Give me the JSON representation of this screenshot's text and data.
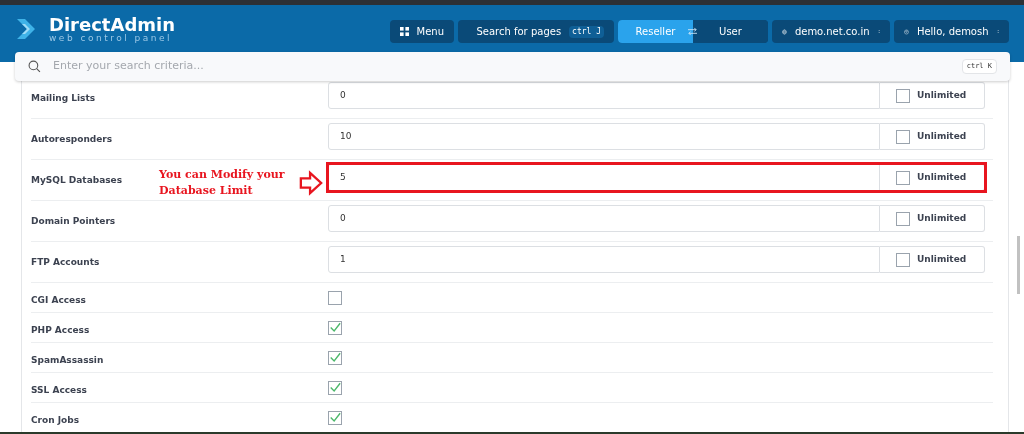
{
  "header": {
    "logo_title": "DirectAdmin",
    "logo_subtitle": "web control panel",
    "menu_button": "Menu",
    "page_search": {
      "label": "Search for pages",
      "shortcut": "ctrl J"
    },
    "role_switch": [
      {
        "label": "Reseller",
        "selected": true
      },
      {
        "label": "User",
        "selected": false
      }
    ],
    "domain_select": "demo.net.co.in",
    "user_menu": "Hello, demosh"
  },
  "search": {
    "placeholder": "Enter your search criteria...",
    "shortcut": "ctrl K"
  },
  "rows": [
    {
      "kind": "number",
      "label": "Mailing Lists",
      "value": "0",
      "unlimited_label": "Unlimited",
      "unlimited": false,
      "highlighted": false
    },
    {
      "kind": "number",
      "label": "Autoresponders",
      "value": "10",
      "unlimited_label": "Unlimited",
      "unlimited": false,
      "highlighted": false
    },
    {
      "kind": "number",
      "label": "MySQL Databases",
      "value": "5",
      "unlimited_label": "Unlimited",
      "unlimited": false,
      "highlighted": true
    },
    {
      "kind": "number",
      "label": "Domain Pointers",
      "value": "0",
      "unlimited_label": "Unlimited",
      "unlimited": false,
      "highlighted": false
    },
    {
      "kind": "number",
      "label": "FTP Accounts",
      "value": "1",
      "unlimited_label": "Unlimited",
      "unlimited": false,
      "highlighted": false
    },
    {
      "kind": "toggle",
      "label": "CGI Access",
      "checked": false
    },
    {
      "kind": "toggle",
      "label": "PHP Access",
      "checked": true
    },
    {
      "kind": "toggle",
      "label": "SpamAssassin",
      "checked": true
    },
    {
      "kind": "toggle",
      "label": "SSL Access",
      "checked": true
    },
    {
      "kind": "toggle",
      "label": "Cron Jobs",
      "checked": true
    }
  ],
  "annotation": {
    "text": "You can Modify your Database Limit"
  }
}
